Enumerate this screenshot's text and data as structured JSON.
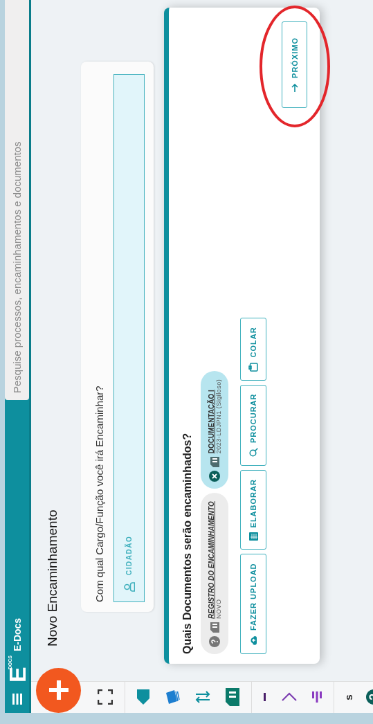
{
  "header": {
    "logo": {
      "letter": "E",
      "caption": "DOCS"
    },
    "app_name": "E-Docs"
  },
  "search": {
    "placeholder": "Pesquise processos, encaminhamentos e documentos"
  },
  "page_title": "Novo Encaminhamento",
  "role_card": {
    "question": "Com qual Cargo/Função você irá Encaminhar?",
    "selection": "CIDADÃO"
  },
  "documents_card": {
    "question": "Quais Documentos serão encaminhados?",
    "documents": [
      {
        "kind": "new",
        "title": "REGISTRO DO ENCAMINHAMENTO",
        "subtitle": "NOVO"
      },
      {
        "kind": "attached",
        "title": "DOCUMENTAÇÃO I",
        "subtitle": "2023-LDJPN1 (Sigiloso)"
      }
    ],
    "actions": [
      {
        "kind": "upload",
        "label": "FAZER UPLOAD"
      },
      {
        "kind": "create",
        "label": "ELABORAR"
      },
      {
        "kind": "search",
        "label": "PROCURAR"
      },
      {
        "kind": "paste",
        "label": "COLAR"
      }
    ],
    "next_button": "PRÓXIMO"
  },
  "toolbar": {
    "text": "s"
  }
}
